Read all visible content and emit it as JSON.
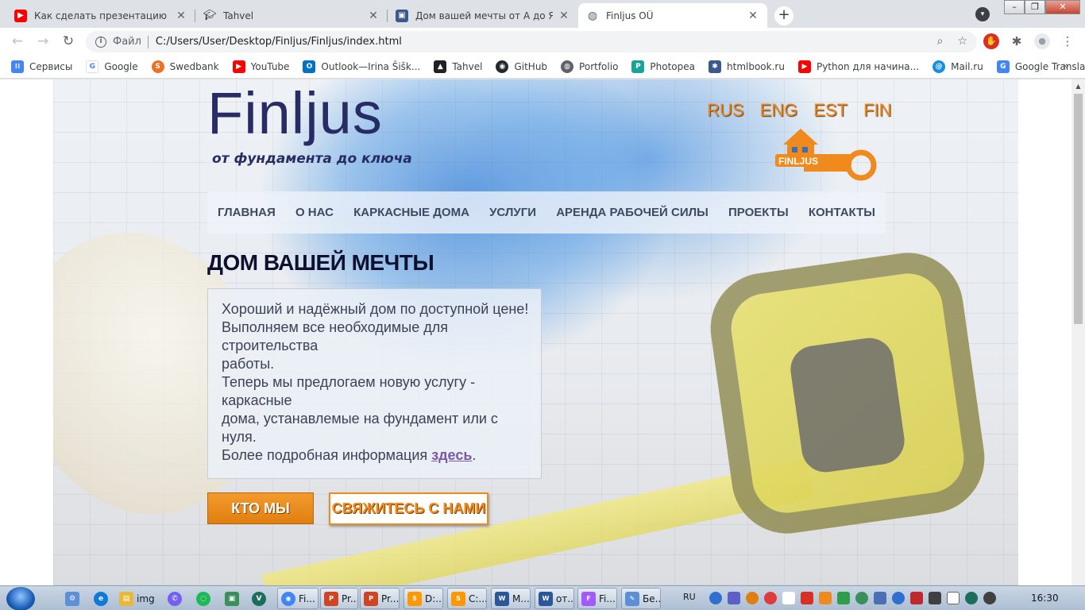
{
  "browser": {
    "tabs": [
      {
        "title": "Как сделать презентацию в PowerPoint",
        "favicon": "youtube-icon",
        "color": "#ff0000"
      },
      {
        "title": "Tahvel",
        "favicon": "graduation-cap-icon",
        "color": "#202124"
      },
      {
        "title": "Дом вашей мечты от А до Я | FINLJUS",
        "favicon": "site-icon",
        "color": "#3a5a8c"
      },
      {
        "title": "Finljus OÜ",
        "favicon": "globe-icon",
        "color": "#5f6368",
        "active": true
      }
    ],
    "new_tab_label": "+",
    "address": {
      "protocol_label": "Файл",
      "url": "C:/Users/User/Desktop/Finljus/Finljus/index.html"
    },
    "bookmarks": [
      {
        "label": "Сервисы",
        "icon": "apps-grid-icon",
        "color": "#4285f4"
      },
      {
        "label": "Google",
        "icon": "google-icon",
        "color": "#4285f4"
      },
      {
        "label": "Swedbank",
        "icon": "swedbank-icon",
        "color": "#ee7023"
      },
      {
        "label": "YouTube",
        "icon": "youtube-icon",
        "color": "#ff0000"
      },
      {
        "label": "Outlook—Irina Šišk...",
        "icon": "outlook-icon",
        "color": "#0072c6"
      },
      {
        "label": "Tahvel",
        "icon": "graduation-cap-icon",
        "color": "#202124"
      },
      {
        "label": "GitHub",
        "icon": "github-icon",
        "color": "#24292e"
      },
      {
        "label": "Portfolio",
        "icon": "globe-icon",
        "color": "#5f6368"
      },
      {
        "label": "Photopea",
        "icon": "photopea-icon",
        "color": "#18a497"
      },
      {
        "label": "htmlbook.ru",
        "icon": "htmlbook-icon",
        "color": "#3a5a8c"
      },
      {
        "label": "Python для начина...",
        "icon": "youtube-icon",
        "color": "#ff0000"
      },
      {
        "label": "Mail.ru",
        "icon": "mailru-icon",
        "color": "#168de2"
      },
      {
        "label": "Google Translate",
        "icon": "translate-icon",
        "color": "#4285f4"
      }
    ],
    "bookmarks_more": "»"
  },
  "site": {
    "logo": {
      "title": "Finljus",
      "tagline": "от фундамента до ключа"
    },
    "languages": [
      "RUS",
      "ENG",
      "EST",
      "FIN"
    ],
    "key_logo_text": "FINLJUS",
    "nav": [
      "ГЛАВНАЯ",
      "О НАС",
      "КАРКАСНЫЕ ДОМА",
      "УСЛУГИ",
      "АРЕНДА РАБОЧЕЙ СИЛЫ",
      "ПРОЕКТЫ",
      "КОНТАКТЫ"
    ],
    "heading": "ДОМ ВАШЕЙ МЕЧТЫ",
    "intro_lines": [
      "Хороший и надёжный дом по доступной цене!",
      "Выполняем все необходимые для",
      "строительства",
      "работы.",
      "Теперь мы предлогаем новую услугу -",
      "каркасные",
      "дома, устанавлемые на фундамент или с",
      "нуля."
    ],
    "more_info_prefix": "Более подробная информация ",
    "more_info_link": "здесь",
    "more_info_suffix": ".",
    "btn_about": "КТО МЫ",
    "btn_contact": "СВЯЖИТЕСЬ С НАМИ",
    "accent_color": "#f08a1c",
    "logo_color": "#272c64"
  },
  "taskbar": {
    "items": [
      {
        "label": "img",
        "icon": "folder-icon",
        "color": "#e8b838"
      }
    ],
    "buttons": [
      {
        "label": "Fi...",
        "icon": "chrome-icon",
        "color": "#4285f4"
      },
      {
        "label": "Pr...",
        "icon": "powerpoint-icon",
        "color": "#d04423"
      },
      {
        "label": "Pr...",
        "icon": "powerpoint-icon",
        "color": "#d04423"
      },
      {
        "label": "D:...",
        "icon": "sublime-icon",
        "color": "#ff9800"
      },
      {
        "label": "C:...",
        "icon": "sublime-icon",
        "color": "#ff9800"
      },
      {
        "label": "M...",
        "icon": "word-icon",
        "color": "#2b579a"
      },
      {
        "label": "от...",
        "icon": "word-icon",
        "color": "#2b579a"
      },
      {
        "label": "Fi...",
        "icon": "figma-icon",
        "color": "#a259ff"
      },
      {
        "label": "Бе...",
        "icon": "paint-icon",
        "color": "#5c8fd6"
      }
    ],
    "language": "RU",
    "clock": "16:30"
  }
}
